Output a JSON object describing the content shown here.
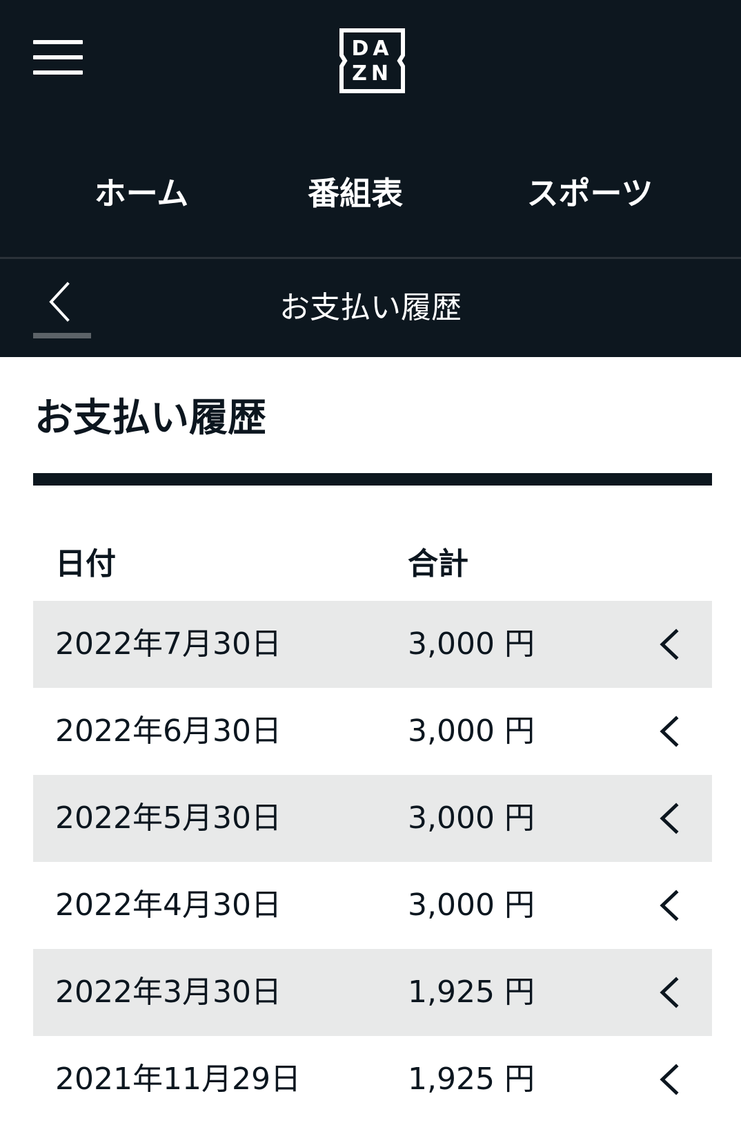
{
  "brand": {
    "logo_line1": "DA",
    "logo_line2": "ZN"
  },
  "nav": {
    "items": [
      {
        "label": "ホーム"
      },
      {
        "label": "番組表"
      },
      {
        "label": "スポーツ"
      }
    ]
  },
  "subheader": {
    "title": "お支払い履歴"
  },
  "page": {
    "title": "お支払い履歴"
  },
  "table": {
    "headers": {
      "date": "日付",
      "total": "合計"
    },
    "rows": [
      {
        "date": "2022年7月30日",
        "amount": "3,000 円"
      },
      {
        "date": "2022年6月30日",
        "amount": "3,000 円"
      },
      {
        "date": "2022年5月30日",
        "amount": "3,000 円"
      },
      {
        "date": "2022年4月30日",
        "amount": "3,000 円"
      },
      {
        "date": "2022年3月30日",
        "amount": "1,925 円"
      },
      {
        "date": "2021年11月29日",
        "amount": "1,925 円"
      }
    ]
  },
  "icons": {
    "menu": "hamburger-menu-icon",
    "back": "chevron-left-icon",
    "row_expand": "chevron-left-icon"
  },
  "colors": {
    "header_bg": "#0d171f",
    "row_shaded": "#e8e9e9",
    "text_primary": "#0c161f",
    "white": "#ffffff"
  }
}
